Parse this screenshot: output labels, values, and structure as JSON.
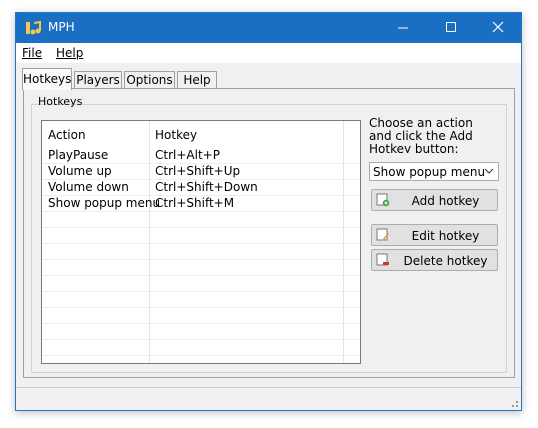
{
  "window": {
    "title": "MPH",
    "app_icon": "music-note-icon",
    "controls": {
      "minimize": "minimize-icon",
      "maximize": "maximize-icon",
      "close": "close-icon"
    }
  },
  "menu": {
    "items": [
      "File",
      "Help"
    ]
  },
  "tabs": [
    "Hotkeys",
    "Players",
    "Options",
    "Help"
  ],
  "active_tab": "Hotkeys",
  "hotkeys_panel": {
    "group_label": "Hotkeys",
    "columns": [
      "Action",
      "Hotkey"
    ],
    "rows": [
      [
        "PlayPause",
        "Ctrl+Alt+P"
      ],
      [
        "Volume up",
        "Ctrl+Shift+Up"
      ],
      [
        "Volume down",
        "Ctrl+Shift+Down"
      ],
      [
        "Show popup menu",
        "Ctrl+Shift+M"
      ]
    ],
    "hint": "Choose an action and click the Add Hotkey button:",
    "action_select": "Show popup menu",
    "buttons": {
      "add": "Add hotkey",
      "edit": "Edit hotkey",
      "delete": "Delete hotkey"
    }
  },
  "colors": {
    "titlebar": "#1b6fc2",
    "window_bg": "#f0f0f0"
  }
}
